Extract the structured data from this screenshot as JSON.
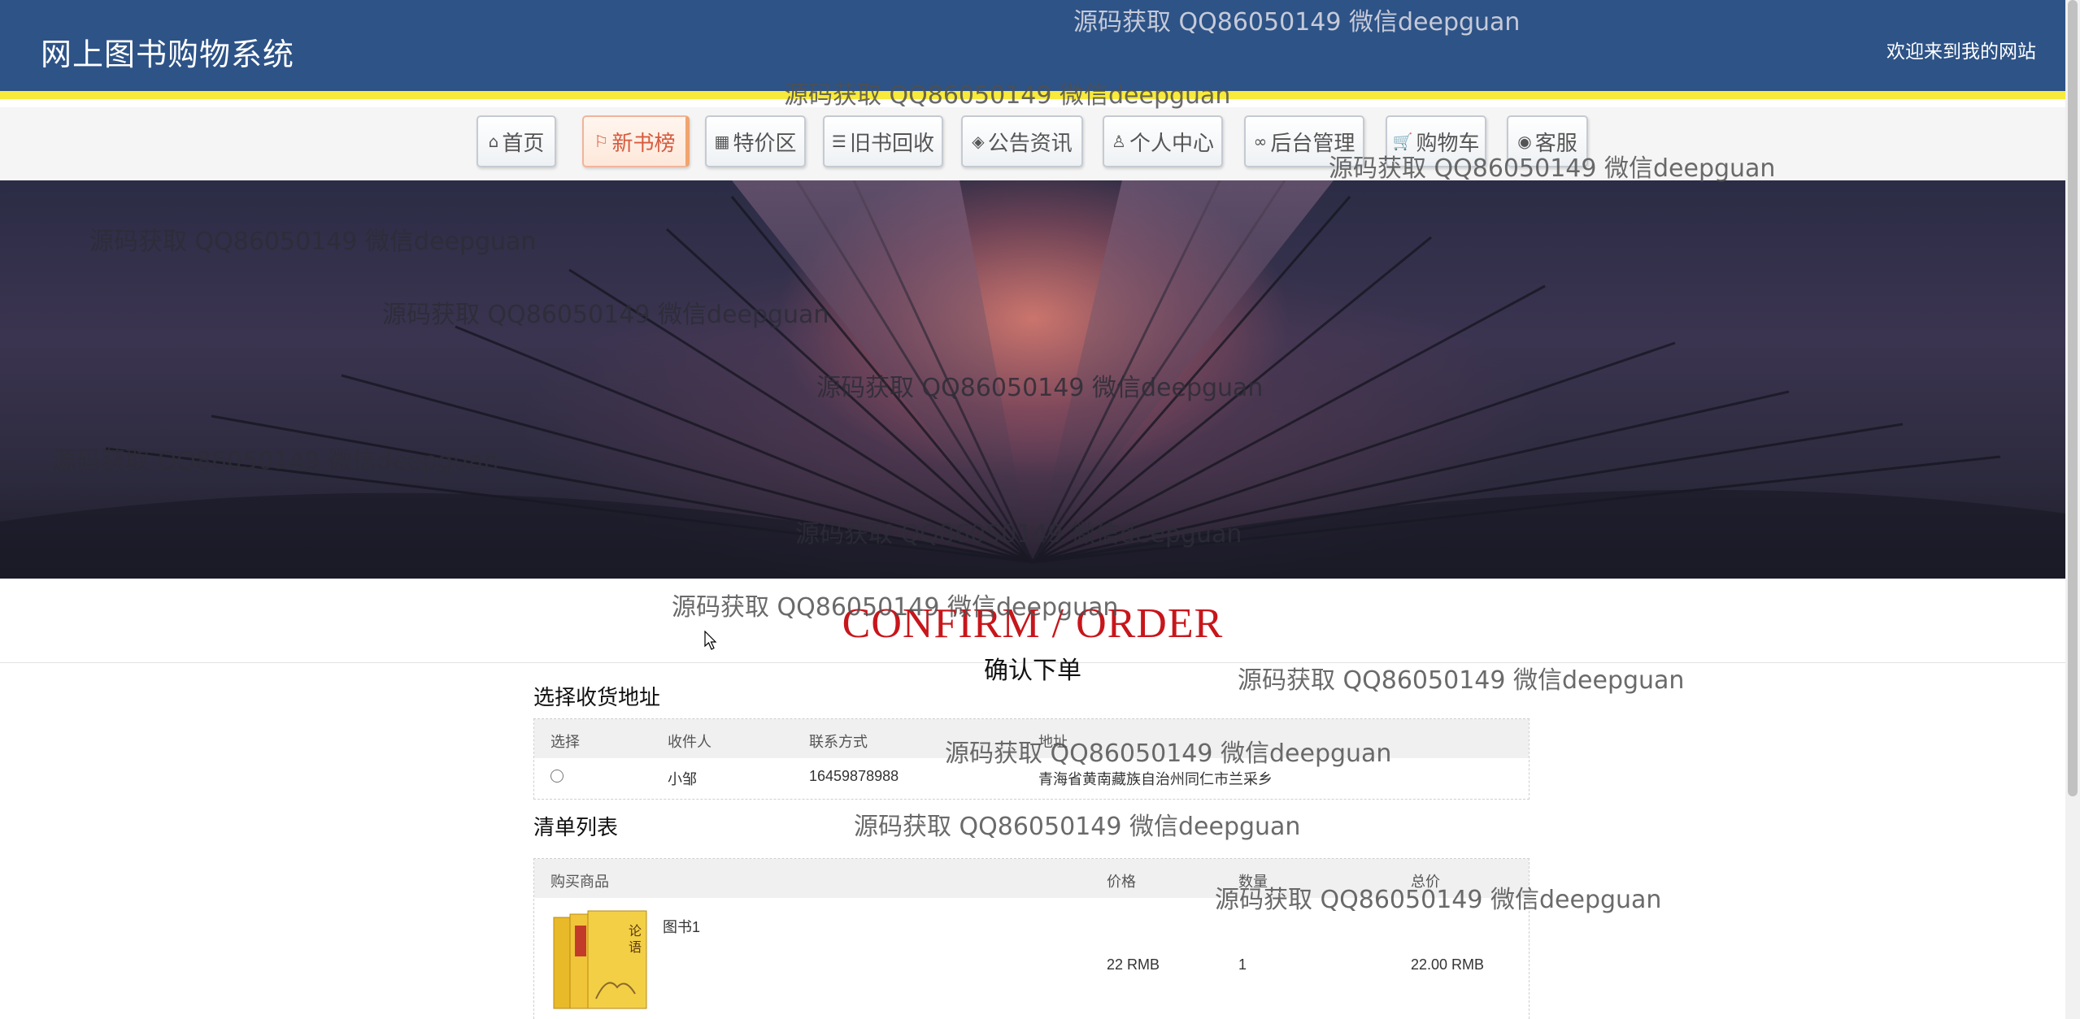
{
  "header": {
    "site_title": "网上图书购物系统",
    "welcome": "欢迎来到我的网站"
  },
  "nav": [
    {
      "label": "首页",
      "icon": "home-icon"
    },
    {
      "label": "新书榜",
      "icon": "flag-icon"
    },
    {
      "label": "特价区",
      "icon": "grid-icon"
    },
    {
      "label": "旧书回收",
      "icon": "sliders-icon"
    },
    {
      "label": "公告资讯",
      "icon": "layers-icon"
    },
    {
      "label": "个人中心",
      "icon": "user-icon"
    },
    {
      "label": "后台管理",
      "icon": "link-icon"
    },
    {
      "label": "购物车",
      "icon": "cart-icon"
    },
    {
      "label": "客服",
      "icon": "chat-icon"
    }
  ],
  "active_nav": "新书榜",
  "page_title": {
    "en": "CONFIRM / ORDER",
    "cn": "确认下单"
  },
  "address_section": {
    "title": "选择收货地址",
    "columns": [
      "选择",
      "收件人",
      "联系方式",
      "地址"
    ],
    "rows": [
      {
        "name": "小邹",
        "phone": "16459878988",
        "address": "青海省黄南藏族自治州同仁市兰采乡"
      }
    ]
  },
  "list_section": {
    "title": "清单列表",
    "columns": [
      "购买商品",
      "价格",
      "数量",
      "总价"
    ],
    "rows": [
      {
        "name": "图书1",
        "price": "22 RMB",
        "qty": "1",
        "total": "22.00 RMB"
      }
    ]
  },
  "watermark": "源码获取 QQ86050149 微信deepguan",
  "colors": {
    "header": "#2d5387",
    "accent_line": "#f7ea3c",
    "title_red": "#c7161b",
    "active_nav": "#d65b3e"
  }
}
